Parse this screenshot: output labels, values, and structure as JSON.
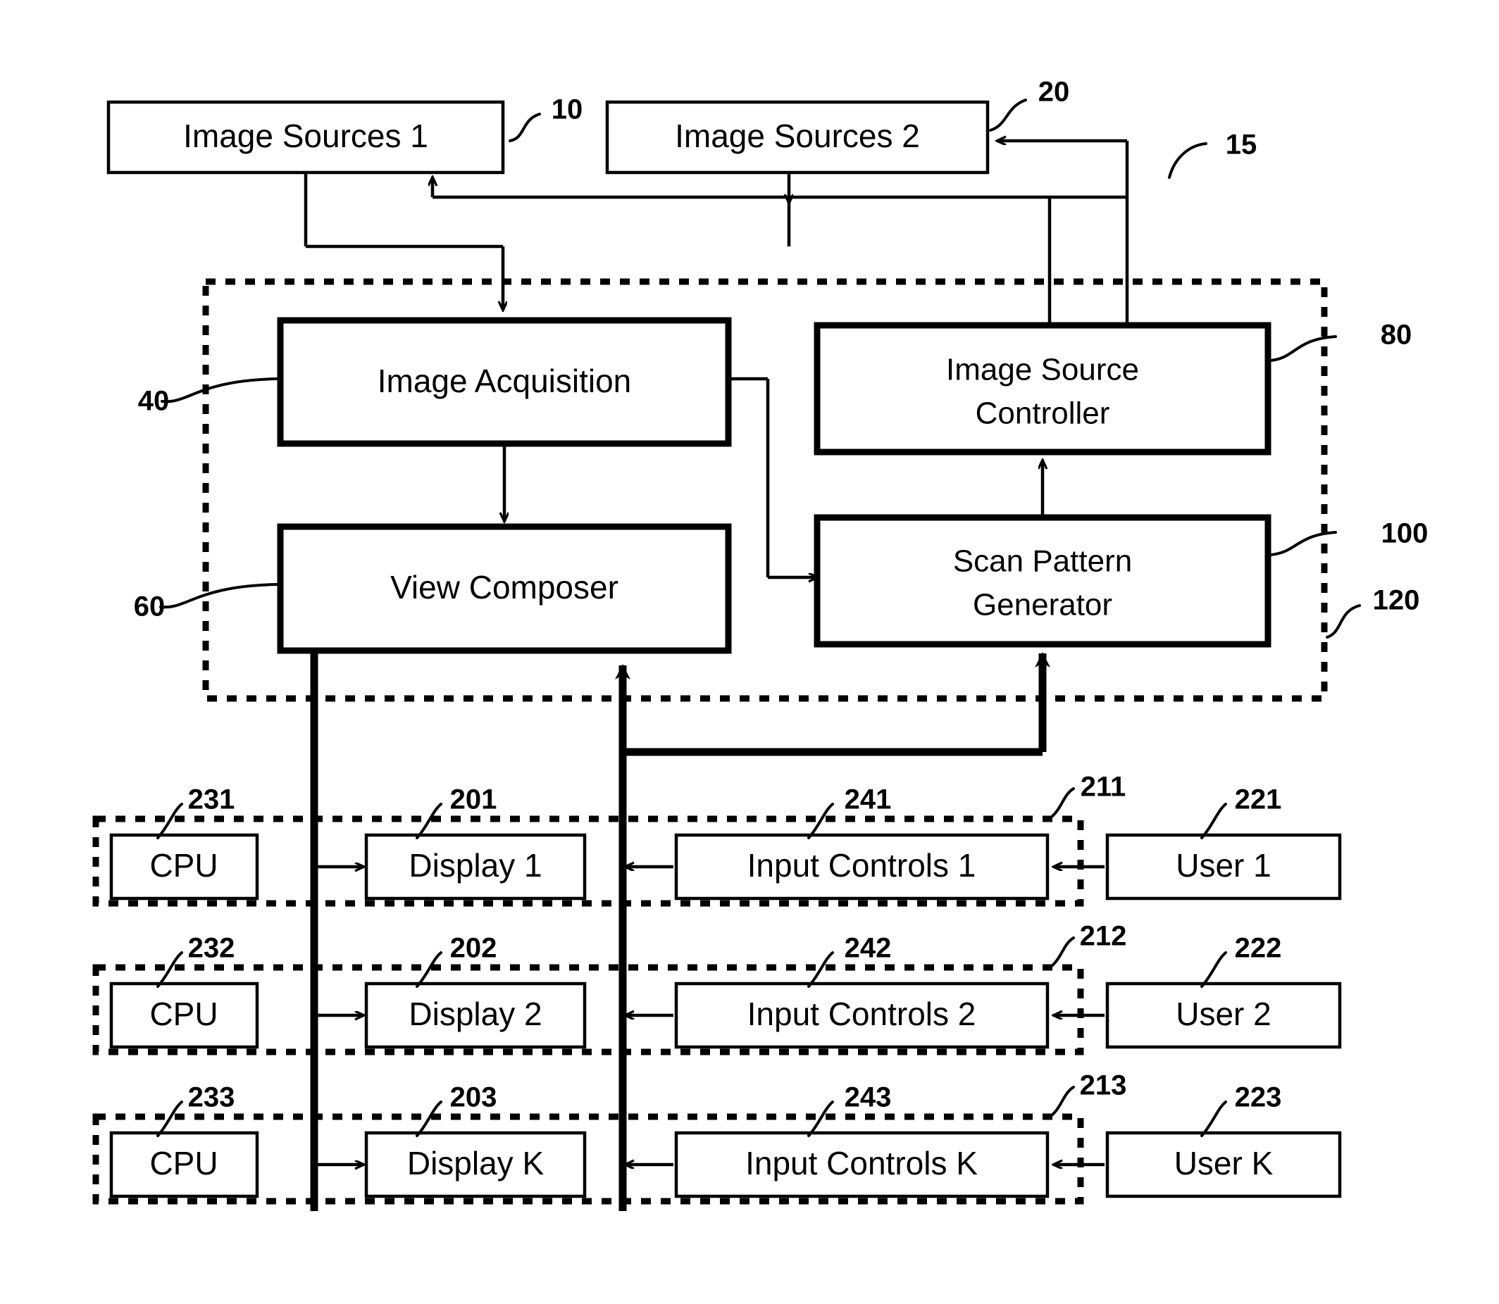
{
  "figure": {
    "type": "patent-block-diagram",
    "background_color": "#ffffff",
    "line_color": "#000000"
  },
  "blocks": {
    "image_sources_1": {
      "label": "Image Sources 1",
      "ref": "10"
    },
    "image_sources_2": {
      "label": "Image Sources 2",
      "ref": "20"
    },
    "system": {
      "ref": "15"
    },
    "image_acquisition": {
      "label": "Image Acquisition",
      "ref": "40"
    },
    "image_source_controller": {
      "label_line1": "Image Source",
      "label_line2": "Controller",
      "ref": "80"
    },
    "view_composer": {
      "label": "View Composer",
      "ref": "60"
    },
    "scan_pattern_generator": {
      "label_line1": "Scan Pattern",
      "label_line2": "Generator",
      "ref": "100"
    },
    "processing_enclosure": {
      "ref": "120"
    }
  },
  "stations": [
    {
      "cpu": {
        "label": "CPU",
        "ref": "231"
      },
      "display": {
        "label": "Display 1",
        "ref": "201"
      },
      "input_controls": {
        "label": "Input Controls 1",
        "ref": "241"
      },
      "station": {
        "ref": "211"
      },
      "user": {
        "label": "User 1",
        "ref": "221"
      }
    },
    {
      "cpu": {
        "label": "CPU",
        "ref": "232"
      },
      "display": {
        "label": "Display 2",
        "ref": "202"
      },
      "input_controls": {
        "label": "Input Controls 2",
        "ref": "242"
      },
      "station": {
        "ref": "212"
      },
      "user": {
        "label": "User 2",
        "ref": "222"
      }
    },
    {
      "cpu": {
        "label": "CPU",
        "ref": "233"
      },
      "display": {
        "label": "Display K",
        "ref": "203"
      },
      "input_controls": {
        "label": "Input Controls K",
        "ref": "243"
      },
      "station": {
        "ref": "213"
      },
      "user": {
        "label": "User K",
        "ref": "223"
      }
    }
  ]
}
